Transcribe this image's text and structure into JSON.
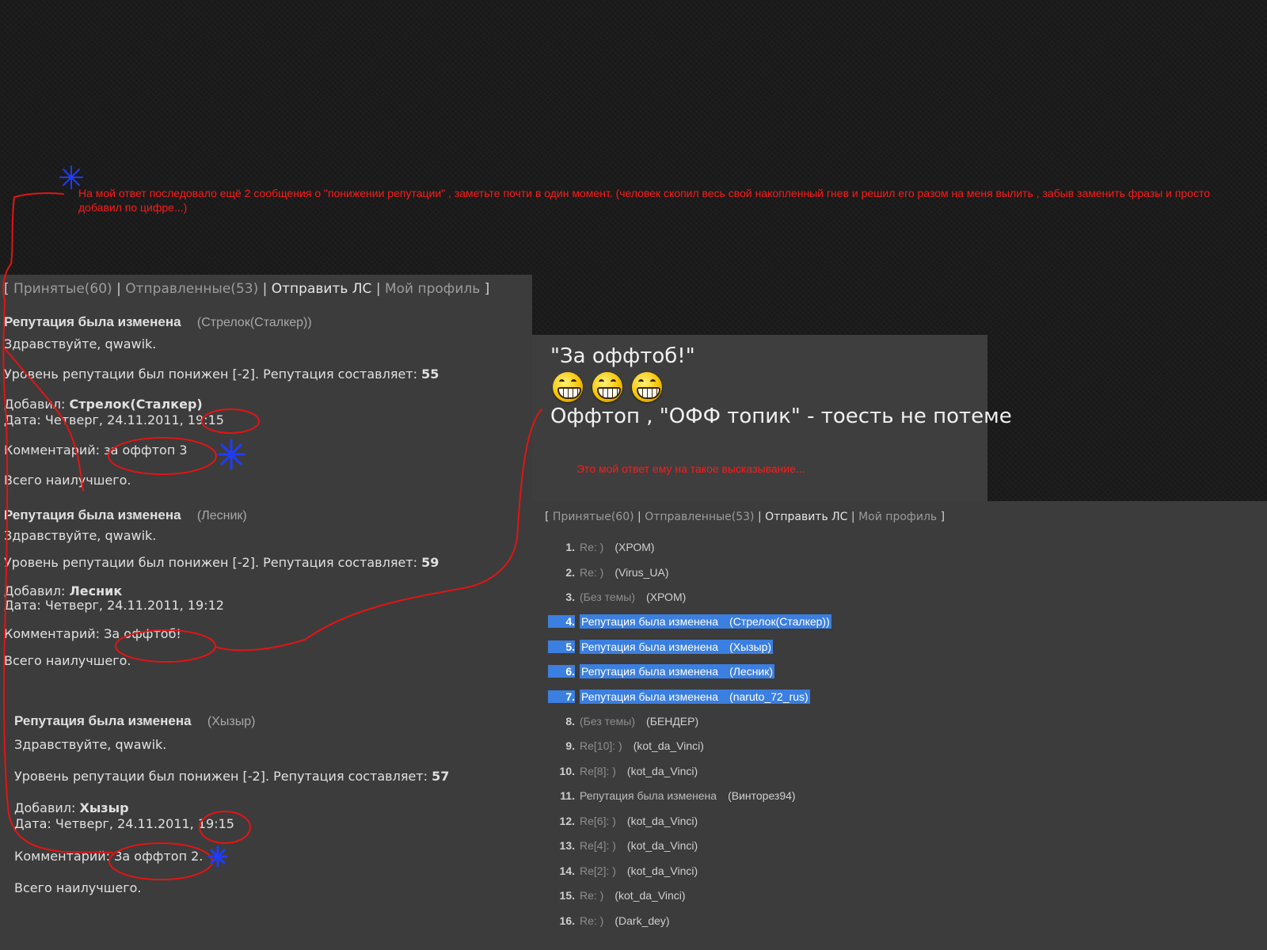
{
  "annotations": {
    "top_note": "На мой ответ последовало ещё 2 сообщения о \"понижении репутации\" , заметьте почти в один момент. (человек скопил весь свой накопленный гнев и решил его разом на меня вылить , забыв заменить фразы и просто добавил по цифре...)",
    "mid_note": "Это мой ответ ему на такое высказывание..."
  },
  "nav": {
    "open": "[",
    "received": "Принятые(60)",
    "sent": "Отправленные(53)",
    "send_pm": "Отправить ЛС",
    "profile": "Мой профиль",
    "close": "]",
    "sep": "|"
  },
  "labels": {
    "greeting": "Здравствуйте, qwawik.",
    "rep_lowered": "Уровень репутации был понижен [-2]. Репутация составляет:",
    "added_by": "Добавил:",
    "date": "Дата:",
    "comment": "Комментарий:",
    "farewell": "Всего наилучшего."
  },
  "messages": [
    {
      "subject": "Репутация была изменена",
      "sender": "(Стрелок(Сталкер))",
      "reputation": "55",
      "author": "Стрелок(Сталкер)",
      "date": "Четверг, 24.11.2011,",
      "time": "19:15",
      "comment": "за оффтоп 3"
    },
    {
      "subject": "Репутация была изменена",
      "sender": "(Лесник)",
      "reputation": "59",
      "author": "Лесник",
      "date": "Четверг, 24.11.2011,",
      "time": "19:12",
      "comment": "За оффтоб!"
    },
    {
      "subject": "Репутация была изменена",
      "sender": "(Хызыр)",
      "reputation": "57",
      "author": "Хызыр",
      "date": "Четверг, 24.11.2011,",
      "time": "19:15",
      "comment": "За оффтоп 2."
    }
  ],
  "quote": {
    "title": "\"За оффтоб!\"",
    "explanation": "Оффтоп , \"ОФФ топик\" - тоесть не потеме",
    "smileys": [
      "grin-smiley-icon",
      "grin-smiley-icon",
      "grin-smiley-icon"
    ]
  },
  "inbox": [
    {
      "num": "1.",
      "subject": "Re: )",
      "from": "(ХРОМ)",
      "highlighted": false
    },
    {
      "num": "2.",
      "subject": "Re: )",
      "from": "(Virus_UA)",
      "highlighted": false
    },
    {
      "num": "3.",
      "subject": "(Без темы)",
      "from": "(ХРОМ)",
      "highlighted": false
    },
    {
      "num": "4.",
      "subject": "Репутация была изменена",
      "from": "(Стрелок(Сталкер))",
      "highlighted": true
    },
    {
      "num": "5.",
      "subject": "Репутация была изменена",
      "from": "(Хызыр)",
      "highlighted": true
    },
    {
      "num": "6.",
      "subject": "Репутация была изменена",
      "from": "(Лесник)",
      "highlighted": true
    },
    {
      "num": "7.",
      "subject": "Репутация была изменена",
      "from": "(naruto_72_rus)",
      "highlighted": true
    },
    {
      "num": "8.",
      "subject": "(Без темы)",
      "from": "(БЕНДЕР)",
      "highlighted": false
    },
    {
      "num": "9.",
      "subject": "Re[10]: )",
      "from": "(kot_da_Vinci)",
      "highlighted": false
    },
    {
      "num": "10.",
      "subject": "Re[8]: )",
      "from": "(kot_da_Vinci)",
      "highlighted": false
    },
    {
      "num": "11.",
      "subject": "Репутация была изменена",
      "from": "(Винторез94)",
      "highlighted": false
    },
    {
      "num": "12.",
      "subject": "Re[6]: )",
      "from": "(kot_da_Vinci)",
      "highlighted": false
    },
    {
      "num": "13.",
      "subject": "Re[4]: )",
      "from": "(kot_da_Vinci)",
      "highlighted": false
    },
    {
      "num": "14.",
      "subject": "Re[2]: )",
      "from": "(kot_da_Vinci)",
      "highlighted": false
    },
    {
      "num": "15.",
      "subject": "Re: )",
      "from": "(kot_da_Vinci)",
      "highlighted": false
    },
    {
      "num": "16.",
      "subject": "Re: )",
      "from": "(Dark_dey)",
      "highlighted": false
    }
  ],
  "colors": {
    "annotation_red": "#ff1a1a",
    "annotation_blue": "#1f3cff",
    "highlight_blue": "#3b7fe0"
  }
}
